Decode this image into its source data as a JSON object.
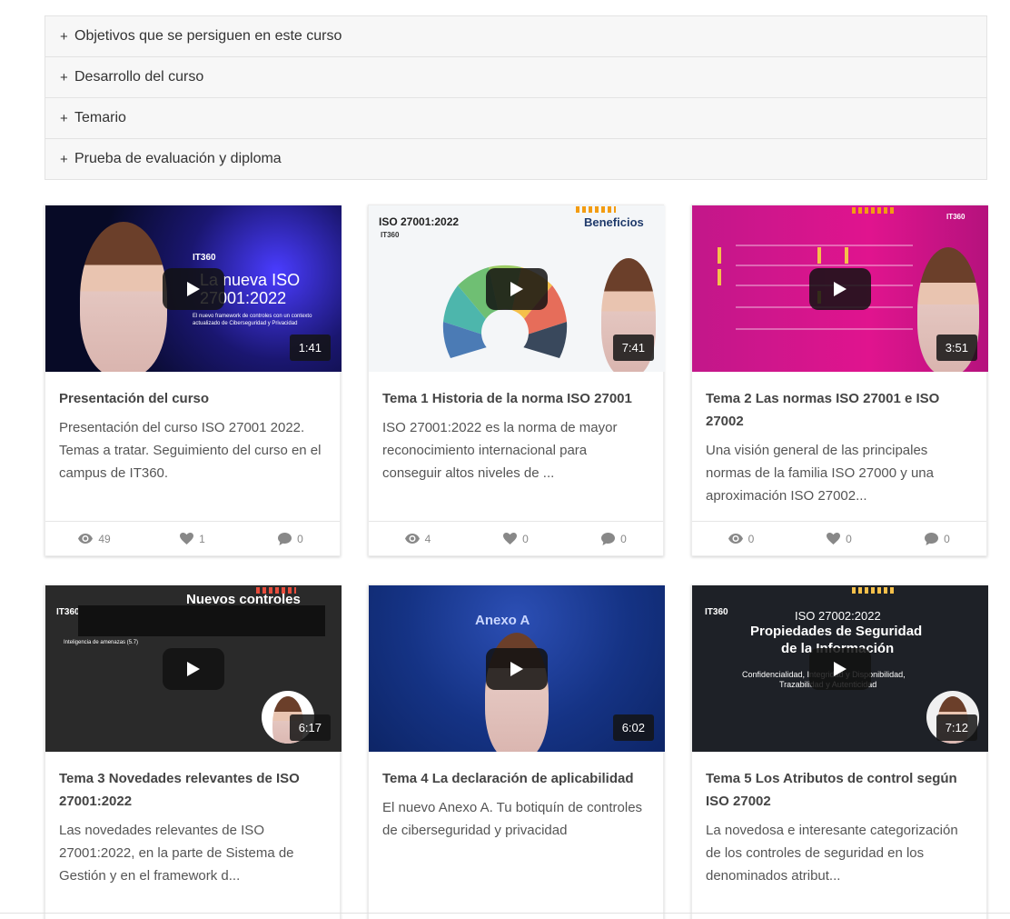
{
  "accordion": [
    {
      "label": "Objetivos que se persiguen en este curso"
    },
    {
      "label": "Desarrollo del curso"
    },
    {
      "label": "Temario"
    },
    {
      "label": "Prueba de evaluación y diploma"
    }
  ],
  "plus_symbol": "+",
  "cards": [
    {
      "title": "Presentación del curso",
      "description": "Presentación del curso ISO 27001 2022. Temas a tratar. Seguimiento del curso en el campus de IT360.",
      "duration": "1:41",
      "views": "49",
      "likes": "1",
      "comments": "0",
      "thumb": {
        "logo": "IT360",
        "line1": "La nueva ISO",
        "line2": "27001:2022",
        "small": "El nuevo framework de controles con un contexto actualizado de Ciberseguridad y Privacidad"
      }
    },
    {
      "title": "Tema 1 Historia de la norma ISO 27001",
      "description": "ISO 27001:2022 es la norma de mayor reconocimiento internacional para conseguir altos niveles de ...",
      "duration": "7:41",
      "views": "4",
      "likes": "0",
      "comments": "0",
      "thumb": {
        "logo": "IT360",
        "heading": "ISO 27001:2022",
        "right": "Beneficios"
      }
    },
    {
      "title": "Tema 2 Las normas ISO 27001 e ISO 27002",
      "description": "Una visión general de las principales normas de la familia ISO 27000 y una aproximación ISO 27002...",
      "duration": "3:51",
      "views": "0",
      "likes": "0",
      "comments": "0",
      "thumb": {
        "logo": "IT360"
      }
    },
    {
      "title": "Tema 3 Novedades relevantes de ISO 27001:2022",
      "description": "Las novedades relevantes de ISO 27001:2022, en la parte de Sistema de Gestión y en el framework d...",
      "duration": "6:17",
      "thumb": {
        "logo": "IT360",
        "heading": "Nuevos controles",
        "sub": "Inteligencia de amenazas (5.7)"
      }
    },
    {
      "title": "Tema 4 La declaración de aplicabilidad",
      "description": "El nuevo Anexo A. Tu botiquín de controles de ciberseguridad y privacidad",
      "duration": "6:02",
      "thumb": {
        "heading": "Anexo A"
      }
    },
    {
      "title": "Tema 5 Los Atributos de control según ISO 27002",
      "description": "La novedosa e interesante categorización de los controles de seguridad en los denominados atribut...",
      "duration": "7:12",
      "thumb": {
        "logo": "IT360",
        "line1": "ISO 27002:2022",
        "line2": "Propiedades de Seguridad",
        "line3": "de la Información",
        "small1": "Confidencialidad, Integridad y Disponibilidad,",
        "small2": "Trazabilidad y Autenticidad"
      }
    }
  ],
  "colors": {
    "accordion_bg": "#f7f7f7",
    "stat_text": "#888888",
    "title_text": "#444444"
  }
}
